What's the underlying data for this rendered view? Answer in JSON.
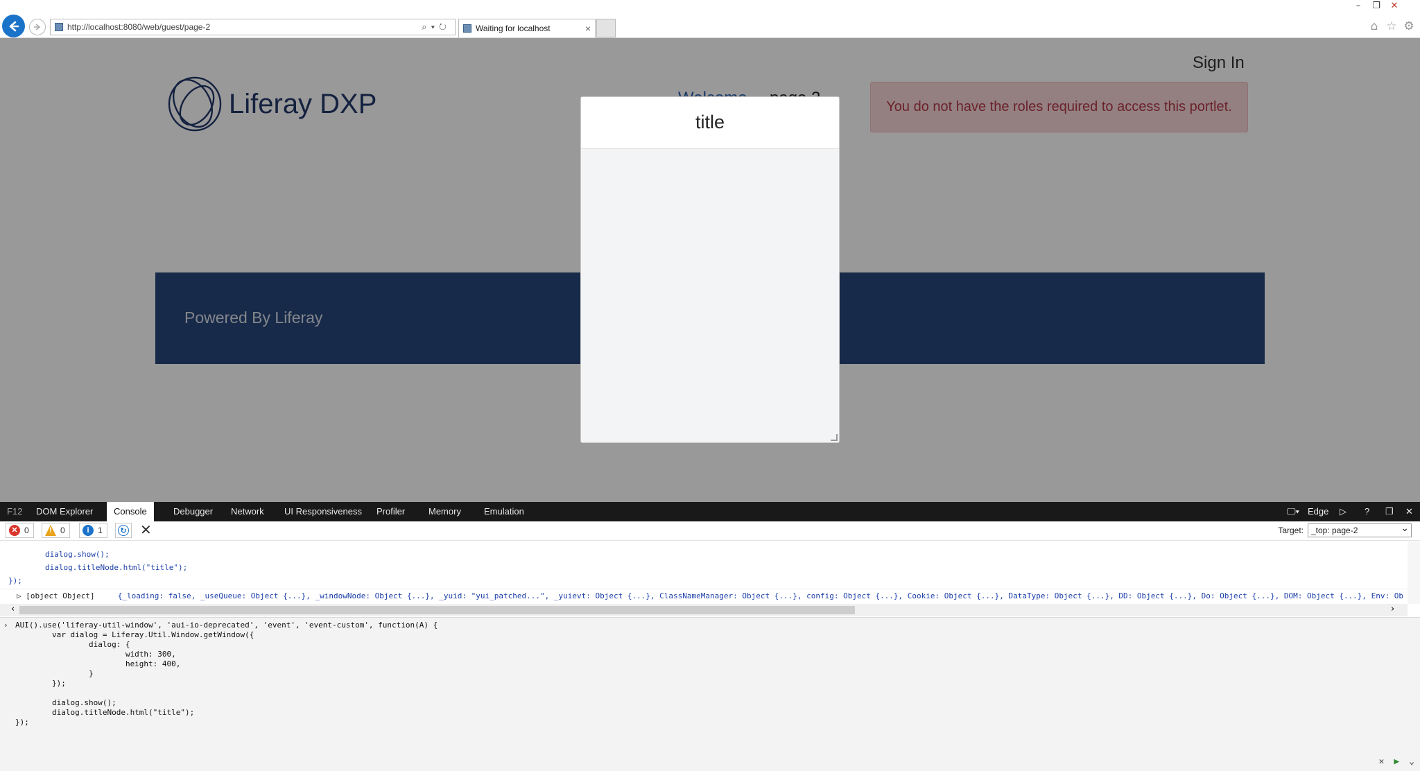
{
  "browser": {
    "url": "http://localhost:8080/web/guest/page-2",
    "tab_title": "Waiting for localhost",
    "tab_close": "×",
    "window_controls": {
      "minimize": "–",
      "restore": "❐",
      "close": "✕"
    },
    "tools": {
      "home": "⌂",
      "favorites": "☆",
      "settings": "⚙"
    }
  },
  "page": {
    "logo_text": "Liferay DXP",
    "sign_in": "Sign In",
    "nav": [
      "Welcome",
      "page 2"
    ],
    "alert": "You do not have the roles required to access this portlet.",
    "footer_text": "Powered By Liferay"
  },
  "dialog": {
    "title": "title"
  },
  "devtools": {
    "f12_label": "F12",
    "tabs": [
      "DOM Explorer",
      "Console",
      "Debugger",
      "Network",
      "UI Responsiveness",
      "Profiler",
      "Memory",
      "Emulation"
    ],
    "active_tab": "Console",
    "mode": "Edge",
    "counts": {
      "errors": "0",
      "warnings": "0",
      "info": "1"
    },
    "target_label": "Target:",
    "target_value": "_top: page-2",
    "output_lines": [
      "        dialog.show();",
      "        dialog.titleNode.html(\"title\");",
      "});"
    ],
    "object_label": "[object Object]",
    "object_props": "{_loading: false, _useQueue: Object {...}, _windowNode: Object {...}, _yuid: \"yui_patched...\", _yuievt: Object {...}, ClassNameManager: Object {...}, config: Object {...}, Cookie: Object {...}, DataType: Object {...}, DD: Object {...}, Do: Object {...}, DOM: Object {...}, Env: Ob",
    "input_code": "AUI().use('liferay-util-window', 'aui-io-deprecated', 'event', 'event-custom', function(A) {\n        var dialog = Liferay.Util.Window.getWindow({\n                dialog: {\n                        width: 300,\n                        height: 400,\n                }\n        });\n\n        dialog.show();\n        dialog.titleNode.html(\"title\");\n});"
  },
  "colors": {
    "brand_navy": "#29477a",
    "alert_bg": "#f7d5d8",
    "alert_text": "#b23946",
    "link_blue": "#2b5fb0"
  }
}
